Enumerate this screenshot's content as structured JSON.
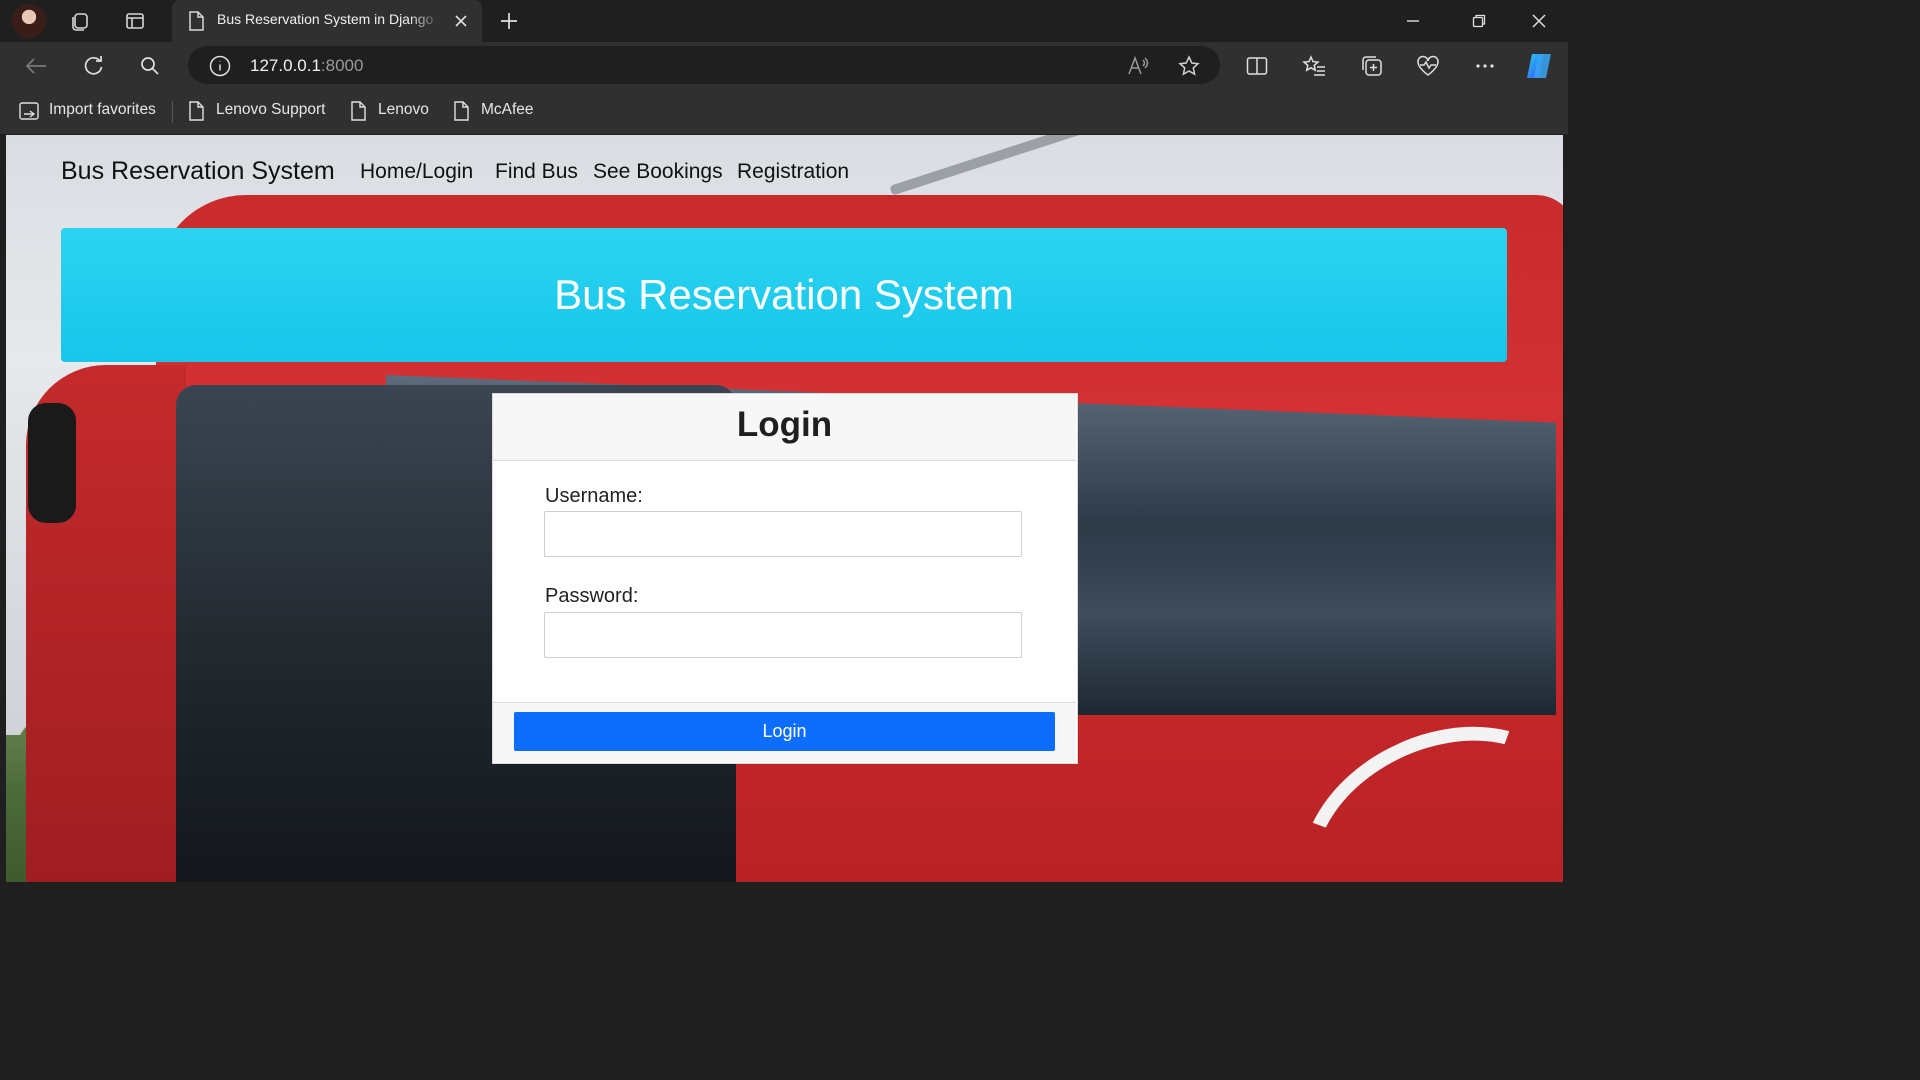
{
  "browser": {
    "tab_title": "Bus Reservation System in Django",
    "address": {
      "host": "127.0.0.1",
      "port": ":8000"
    },
    "favorites": [
      {
        "label": "Import favorites",
        "icon": "import-favorites-icon"
      },
      {
        "label": "Lenovo Support",
        "icon": "page-icon"
      },
      {
        "label": "Lenovo",
        "icon": "page-icon"
      },
      {
        "label": "McAfee",
        "icon": "page-icon"
      }
    ]
  },
  "site": {
    "brand": "Bus Reservation System",
    "nav": [
      "Home/Login",
      "Find Bus",
      "See Bookings",
      "Registration"
    ],
    "hero_title": "Bus Reservation System"
  },
  "login": {
    "title": "Login",
    "username_label": "Username:",
    "username_value": "",
    "password_label": "Password:",
    "password_value": "",
    "submit_label": "Login"
  },
  "colors": {
    "hero": "#17c6ea",
    "primary_button": "#0d6efd",
    "bus_red": "#c92b2d"
  }
}
